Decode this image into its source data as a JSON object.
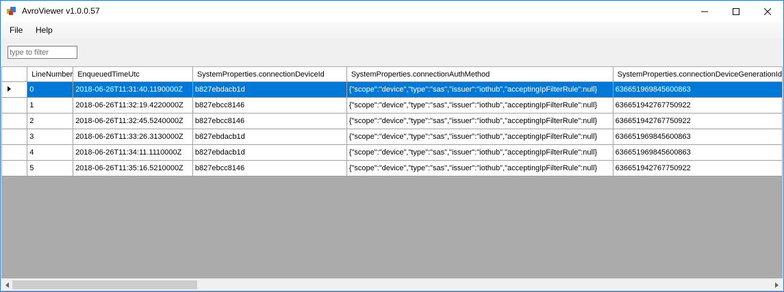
{
  "window": {
    "title": "AvroViewer v1.0.0.57",
    "icons": {
      "app": "app-icon",
      "minimize": "minimize-icon",
      "maximize": "maximize-icon",
      "close": "close-icon"
    }
  },
  "menu": {
    "items": [
      "File",
      "Help"
    ]
  },
  "filter": {
    "placeholder": "type to filter",
    "value": ""
  },
  "grid": {
    "columns": [
      "LineNumber",
      "EnqueuedTimeUtc",
      "SystemProperties.connectionDeviceId",
      "SystemProperties.connectionAuthMethod",
      "SystemProperties.connectionDeviceGenerationId"
    ],
    "selected_row": 0,
    "rows": [
      [
        "0",
        "2018-06-26T11:31:40.1190000Z",
        "b827ebdacb1d",
        "{\"scope\":\"device\",\"type\":\"sas\",\"issuer\":\"iothub\",\"acceptingIpFilterRule\":null}",
        "636651969845600863"
      ],
      [
        "1",
        "2018-06-26T11:32:19.4220000Z",
        "b827ebcc8146",
        "{\"scope\":\"device\",\"type\":\"sas\",\"issuer\":\"iothub\",\"acceptingIpFilterRule\":null}",
        "636651942767750922"
      ],
      [
        "2",
        "2018-06-26T11:32:45.5240000Z",
        "b827ebcc8146",
        "{\"scope\":\"device\",\"type\":\"sas\",\"issuer\":\"iothub\",\"acceptingIpFilterRule\":null}",
        "636651942767750922"
      ],
      [
        "3",
        "2018-06-26T11:33:26.3130000Z",
        "b827ebdacb1d",
        "{\"scope\":\"device\",\"type\":\"sas\",\"issuer\":\"iothub\",\"acceptingIpFilterRule\":null}",
        "636651969845600863"
      ],
      [
        "4",
        "2018-06-26T11:34:11.1110000Z",
        "b827ebdacb1d",
        "{\"scope\":\"device\",\"type\":\"sas\",\"issuer\":\"iothub\",\"acceptingIpFilterRule\":null}",
        "636651969845600863"
      ],
      [
        "5",
        "2018-06-26T11:35:16.5210000Z",
        "b827ebcc8146",
        "{\"scope\":\"device\",\"type\":\"sas\",\"issuer\":\"iothub\",\"acceptingIpFilterRule\":null}",
        "636651942767750922"
      ]
    ]
  },
  "colors": {
    "selection": "#0078d7",
    "grid_background": "#ababab"
  }
}
